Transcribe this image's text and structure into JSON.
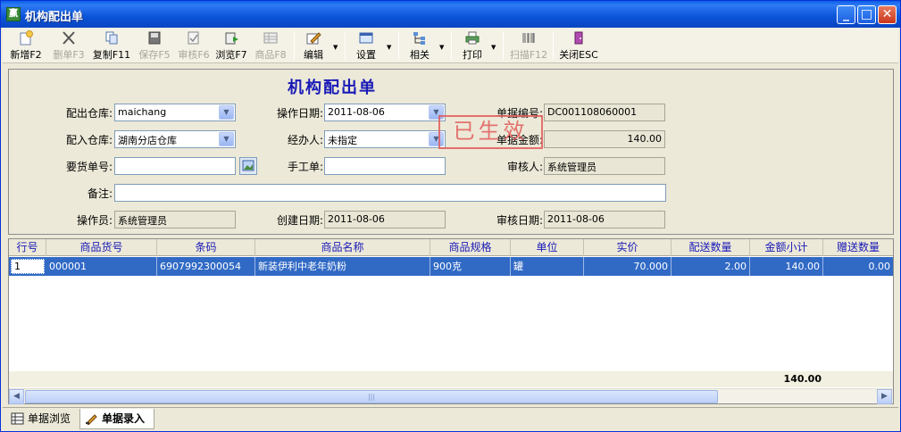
{
  "window": {
    "title": "机构配出单",
    "app_icon_glyph": "赢",
    "controls": {
      "minimize": "_",
      "maximize": "□",
      "close": "✕"
    }
  },
  "toolbar": {
    "buttons": [
      {
        "label": "新增F2",
        "icon": "new-document-icon",
        "enabled": true
      },
      {
        "label": "删单F3",
        "icon": "delete-x-icon",
        "enabled": false
      },
      {
        "label": "复制F11",
        "icon": "copy-icon",
        "enabled": true
      },
      {
        "label": "保存F5",
        "icon": "save-disk-icon",
        "enabled": false
      },
      {
        "label": "审核F6",
        "icon": "audit-check-icon",
        "enabled": false
      },
      {
        "label": "浏览F7",
        "icon": "browse-icon",
        "enabled": true
      },
      {
        "label": "商品F8",
        "icon": "product-list-icon",
        "enabled": false
      },
      {
        "label": "编辑",
        "icon": "edit-pencil-icon",
        "enabled": true,
        "dropdown": true
      },
      {
        "label": "设置",
        "icon": "settings-window-icon",
        "enabled": true,
        "dropdown": true
      },
      {
        "label": "相关",
        "icon": "related-tree-icon",
        "enabled": true,
        "dropdown": true
      },
      {
        "label": "打印",
        "icon": "printer-icon",
        "enabled": true,
        "dropdown": true
      },
      {
        "label": "扫描F12",
        "icon": "barcode-scan-icon",
        "enabled": false
      },
      {
        "label": "关闭ESC",
        "icon": "close-door-icon",
        "enabled": true
      }
    ]
  },
  "form": {
    "title": "机构配出单",
    "out_warehouse": {
      "label": "配出仓库:",
      "value": "maichang"
    },
    "operate_date": {
      "label": "操作日期:",
      "value": "2011-08-06"
    },
    "doc_no": {
      "label": "单据编号:",
      "value": "DC001108060001"
    },
    "in_warehouse": {
      "label": "配入仓库:",
      "value": "湖南分店仓库"
    },
    "handler": {
      "label": "经办人:",
      "value": "未指定"
    },
    "doc_amount": {
      "label": "单据金额:",
      "value": "140.00"
    },
    "request_no": {
      "label": "要货单号:",
      "value": ""
    },
    "manual_no": {
      "label": "手工单:",
      "value": ""
    },
    "auditor": {
      "label": "审核人:",
      "value": "系统管理员"
    },
    "remark": {
      "label": "备注:",
      "value": ""
    },
    "operator": {
      "label": "操作员:",
      "value": "系统管理员"
    },
    "create_date": {
      "label": "创建日期:",
      "value": "2011-08-06"
    },
    "audit_date": {
      "label": "审核日期:",
      "value": "2011-08-06"
    },
    "stamp": "已生效"
  },
  "grid": {
    "columns": [
      "行号",
      "商品货号",
      "条码",
      "商品名称",
      "商品规格",
      "单位",
      "实价",
      "配送数量",
      "金额小计",
      "赠送数量"
    ],
    "rows": [
      {
        "line": "1",
        "item_no": "000001",
        "barcode": "6907992300054",
        "name": "新装伊利中老年奶粉",
        "spec": "900克",
        "unit": "罐",
        "price": "70.000",
        "qty": "2.00",
        "subtotal": "140.00",
        "gift_qty": "0.00"
      }
    ],
    "footer_total": "140.00"
  },
  "tabs": [
    {
      "label": "单据浏览",
      "icon": "list-grid-icon",
      "active": false
    },
    {
      "label": "单据录入",
      "icon": "entry-pencil-icon",
      "active": true
    }
  ],
  "colors": {
    "title_blue": "#0b53d8",
    "selection": "#316ac5",
    "form_title": "#1a1ab8",
    "stamp_red": "#e35b5b"
  }
}
